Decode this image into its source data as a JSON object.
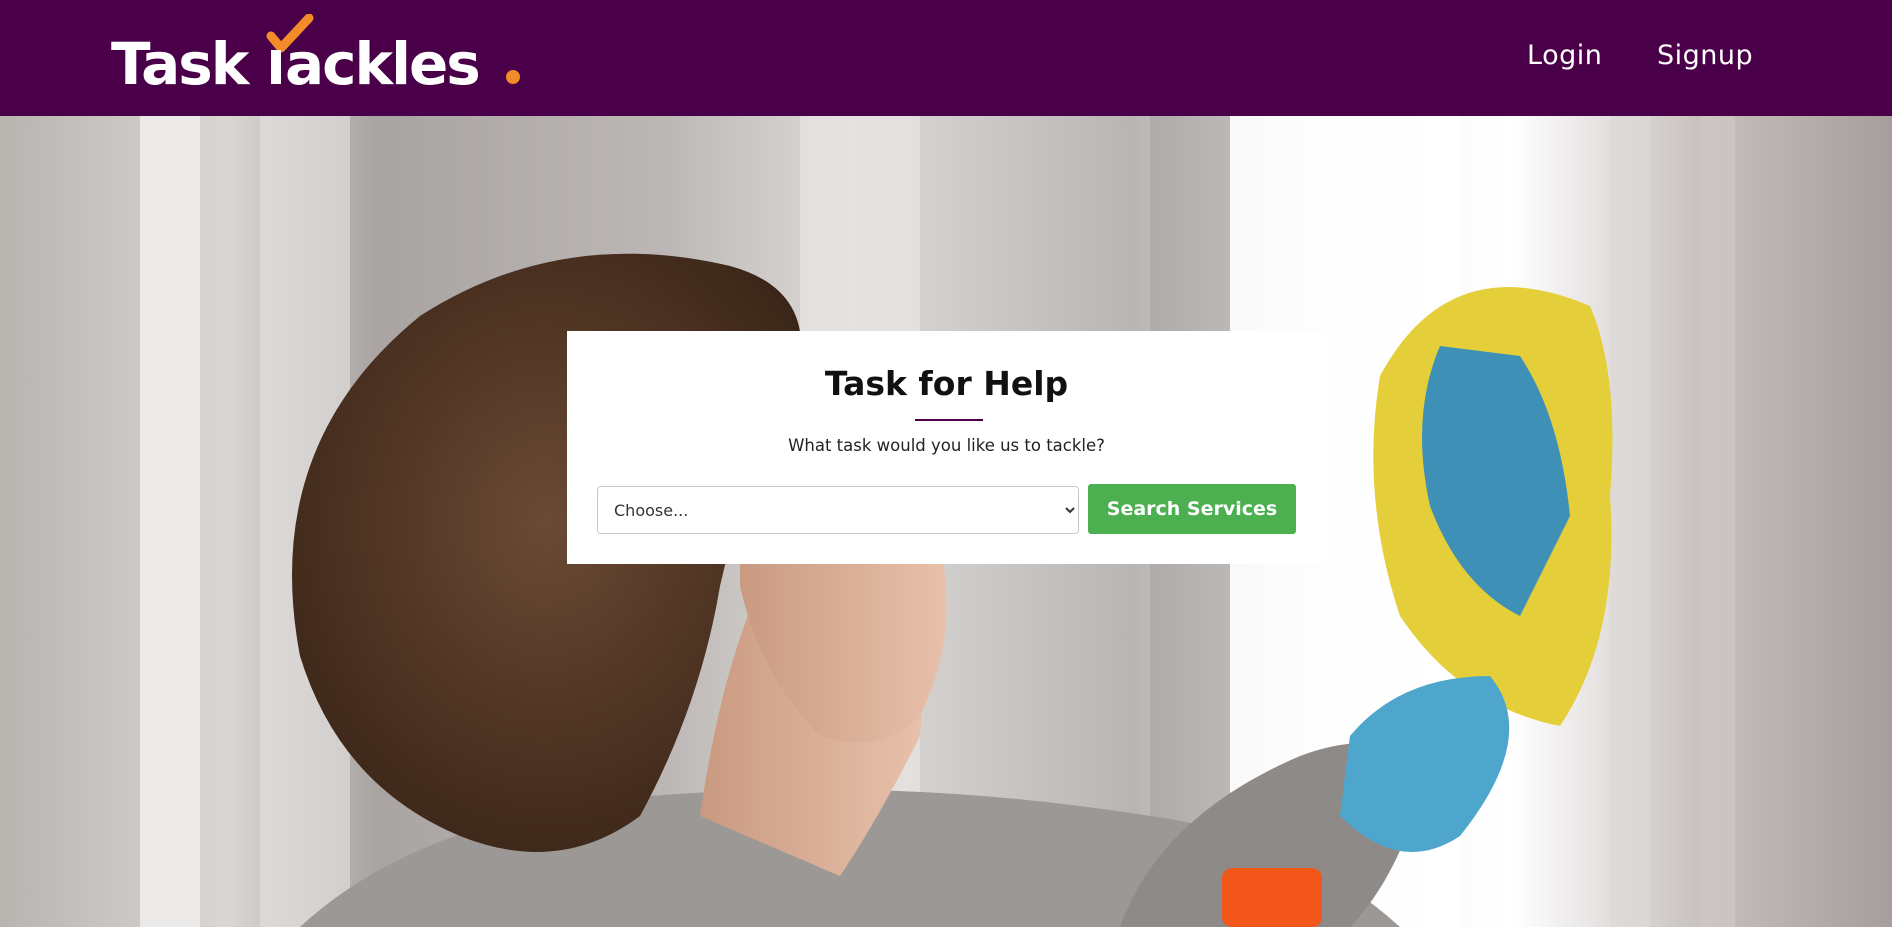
{
  "brand": {
    "logo_text": "TaskTackles.",
    "logo_first": "Task",
    "logo_second": "ackles",
    "logo_dot": ".",
    "colors": {
      "nav_background": "#4a0048",
      "check_orange": "#f28c28",
      "button_green": "#4caf50"
    }
  },
  "nav": {
    "login_label": "Login",
    "signup_label": "Signup"
  },
  "hero": {
    "image_label": "woman-cleaning-window-photo"
  },
  "search_card": {
    "title": "Task for Help",
    "subtitle": "What task would you like us to tackle?",
    "select_value": "Choose...",
    "button_label": "Search Services"
  }
}
